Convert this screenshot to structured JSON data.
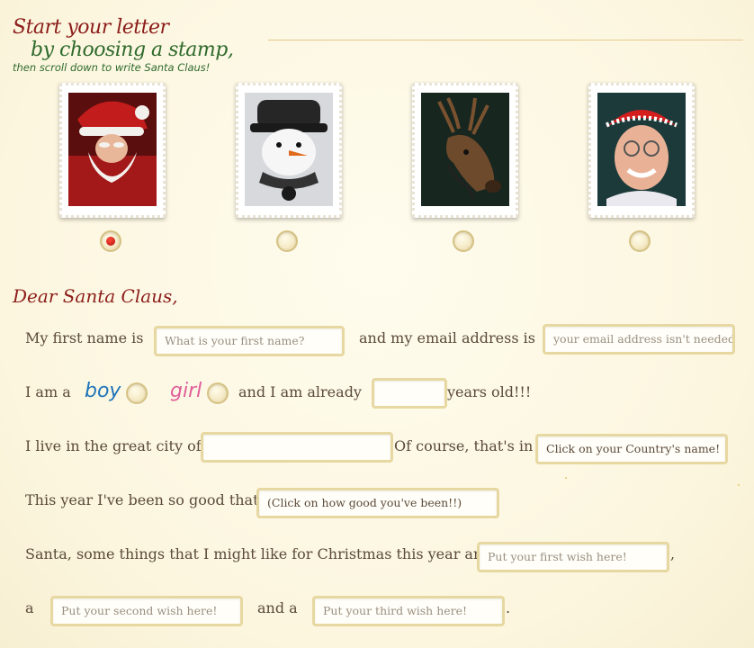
{
  "header": {
    "line1": "Start your letter",
    "line2": "by choosing a stamp,",
    "line3": "then scroll down to write Santa Claus!"
  },
  "stamps": [
    {
      "name": "Santa Claus",
      "selected": true
    },
    {
      "name": "Snowman",
      "selected": false
    },
    {
      "name": "Reindeer",
      "selected": false
    },
    {
      "name": "Mrs. Claus",
      "selected": false
    }
  ],
  "letter": {
    "greeting": "Dear Santa Claus,",
    "first_name_label": "My first name is",
    "first_name_placeholder": "What is your first name?",
    "email_label": "and my email address is",
    "email_placeholder": "your email address isn't needed",
    "i_am_a": "I am a",
    "boy": "boy",
    "girl": "girl",
    "age_label": "and I am already",
    "age_suffix": "years old!!!",
    "city_label": "I live in the great city of",
    "country_label": "Of course, that's in",
    "country_value": "Click on your Country's name!",
    "good_label": "This year I've been so good that",
    "good_value": "(Click on how good you've been!!)",
    "wishes_label": "Santa, some things that I might like for Christmas this year are a",
    "wish1_placeholder": "Put your first wish here!",
    "comma": ",",
    "a_label": "a",
    "wish2_placeholder": "Put your second wish here!",
    "and_a_label": "and a",
    "wish3_placeholder": "Put your third wish here!",
    "period": "."
  },
  "colors": {
    "title_red": "#8b1d1a",
    "title_green": "#2f6a2c",
    "boy_blue": "#1f74b8",
    "girl_pink": "#e15d9a"
  }
}
